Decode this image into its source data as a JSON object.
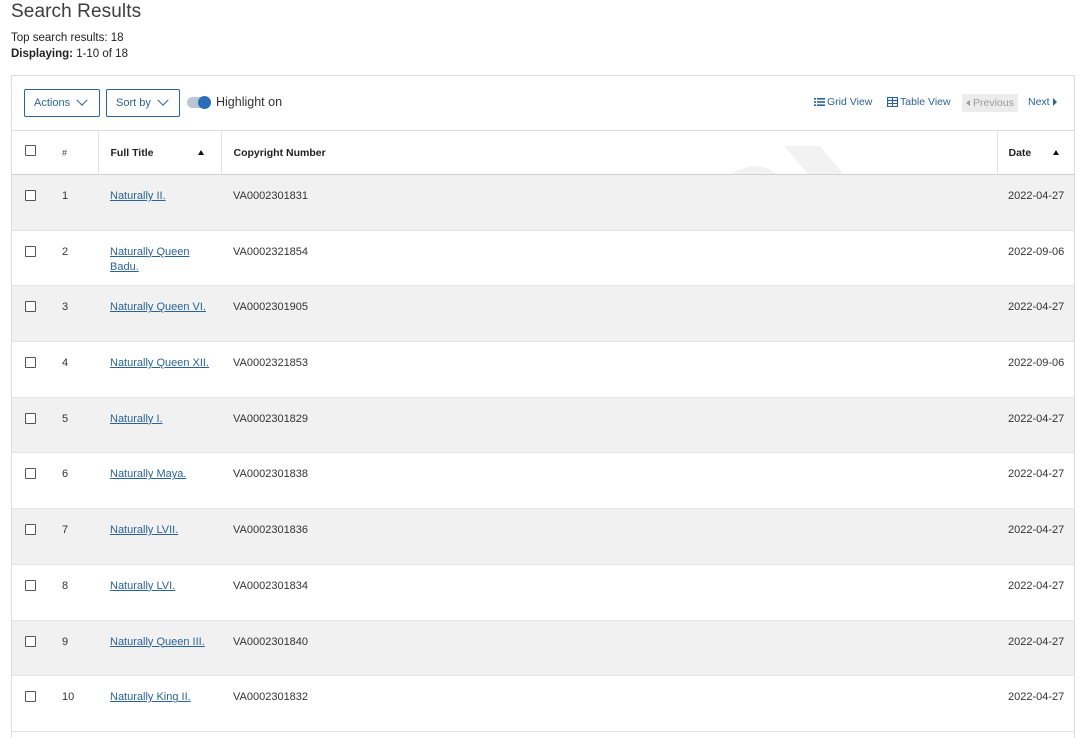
{
  "page": {
    "title": "Search Results",
    "top_results_label": "Top search results: 18",
    "displaying_label": "Displaying:",
    "displaying_value": "1-10 of 18"
  },
  "toolbar": {
    "actions_label": "Actions",
    "sort_label": "Sort by",
    "highlight_label": "Highlight on",
    "highlight_on": true,
    "grid_view_label": "Grid View",
    "table_view_label": "Table View",
    "previous_label": "Previous",
    "next_label": "Next"
  },
  "table": {
    "headers": {
      "number": "#",
      "full_title": "Full Title",
      "copyright_number": "Copyright Number",
      "date": "Date"
    },
    "rows": [
      {
        "num": "1",
        "title": "Naturally II.",
        "copyright": "VA0002301831",
        "date": "2022-04-27"
      },
      {
        "num": "2",
        "title": "Naturally Queen Badu.",
        "copyright": "VA0002321854",
        "date": "2022-09-06"
      },
      {
        "num": "3",
        "title": "Naturally Queen VI.",
        "copyright": "VA0002301905",
        "date": "2022-04-27"
      },
      {
        "num": "4",
        "title": "Naturally Queen XII.",
        "copyright": "VA0002321853",
        "date": "2022-09-06"
      },
      {
        "num": "5",
        "title": "Naturally I.",
        "copyright": "VA0002301829",
        "date": "2022-04-27"
      },
      {
        "num": "6",
        "title": "Naturally Maya.",
        "copyright": "VA0002301838",
        "date": "2022-04-27"
      },
      {
        "num": "7",
        "title": "Naturally LVII.",
        "copyright": "VA0002301836",
        "date": "2022-04-27"
      },
      {
        "num": "8",
        "title": "Naturally LVI.",
        "copyright": "VA0002301834",
        "date": "2022-04-27"
      },
      {
        "num": "9",
        "title": "Naturally Queen III.",
        "copyright": "VA0002301840",
        "date": "2022-04-27"
      },
      {
        "num": "10",
        "title": "Naturally King II.",
        "copyright": "VA0002301832",
        "date": "2022-04-27"
      }
    ]
  },
  "watermark": {
    "text": "123TRD",
    "color": "#eaeaea"
  },
  "colors": {
    "link": "#2a6496",
    "row_shade": "#f1f1f1",
    "toggle_knob": "#2a6eb8"
  }
}
